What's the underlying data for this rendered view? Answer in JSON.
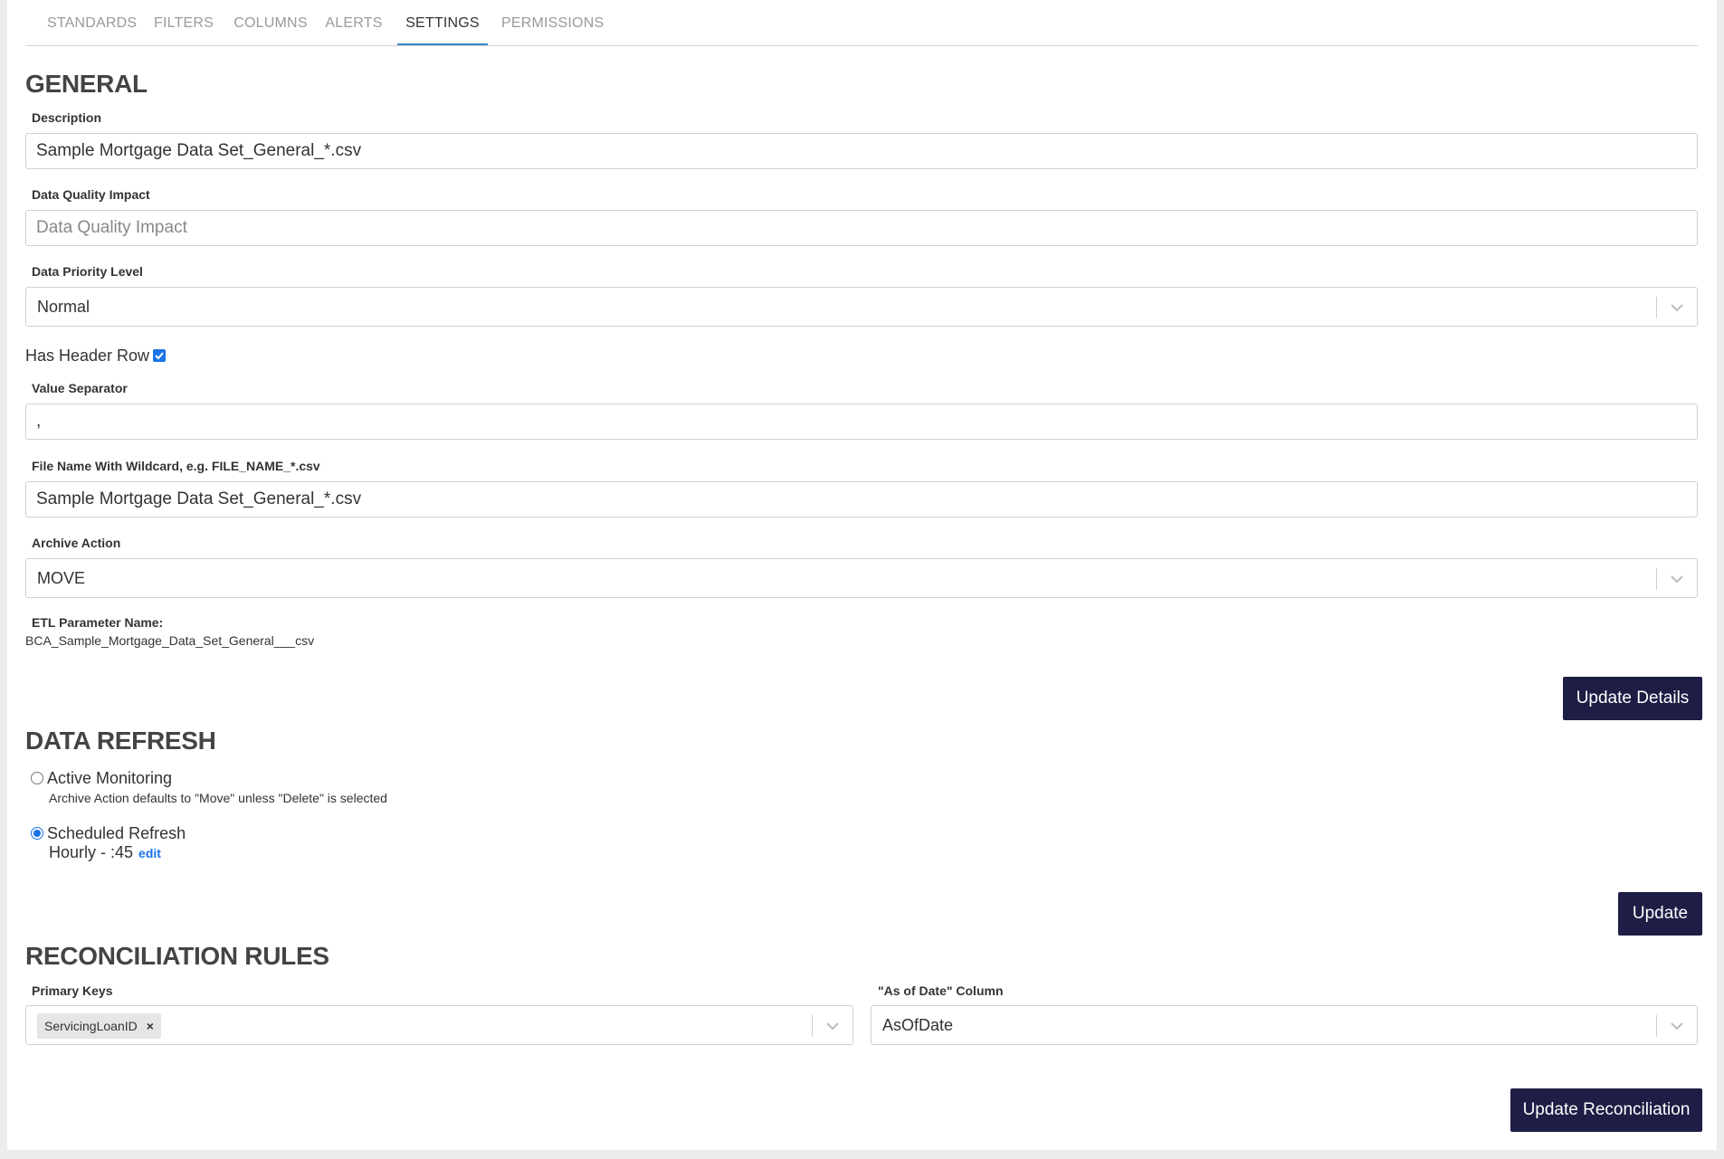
{
  "tabs": [
    "STANDARDS",
    "FILTERS",
    "COLUMNS",
    "ALERTS",
    "SETTINGS",
    "PERMISSIONS"
  ],
  "active_tab": "SETTINGS",
  "general": {
    "title": "GENERAL",
    "description_label": "Description",
    "description_value": "Sample Mortgage Data Set_General_*.csv",
    "dq_impact_label": "Data Quality Impact",
    "dq_impact_placeholder": "Data Quality Impact",
    "priority_label": "Data Priority Level",
    "priority_value": "Normal",
    "header_row_label": "Has Header Row",
    "header_row_checked": true,
    "separator_label": "Value Separator",
    "separator_value": ",",
    "filename_label": "File Name With Wildcard, e.g. FILE_NAME_*.csv",
    "filename_value": "Sample Mortgage Data Set_General_*.csv",
    "archive_label": "Archive Action",
    "archive_value": "MOVE",
    "etl_label": "ETL Parameter Name:",
    "etl_value": "BCA_Sample_Mortgage_Data_Set_General___csv",
    "update_button": "Update Details"
  },
  "refresh": {
    "title": "DATA REFRESH",
    "active_label": "Active Monitoring",
    "active_hint": "Archive Action defaults to \"Move\" unless \"Delete\" is selected",
    "scheduled_label": "Scheduled Refresh",
    "scheduled_detail": "Hourly - :45",
    "edit_label": "edit",
    "selected": "Scheduled Refresh",
    "update_button": "Update"
  },
  "reconciliation": {
    "title": "RECONCILIATION RULES",
    "primary_keys_label": "Primary Keys",
    "primary_keys": [
      "ServicingLoanID"
    ],
    "as_of_date_label": "\"As of Date\" Column",
    "as_of_date_value": "AsOfDate",
    "update_button": "Update Reconciliation"
  },
  "colors": {
    "button_bg": "#1d1d45",
    "accent": "#1a73e8",
    "active_tab_underline": "#3a87c8"
  },
  "icons": [
    "chevron-down-icon",
    "checkmark-icon",
    "remove-tag-icon"
  ]
}
